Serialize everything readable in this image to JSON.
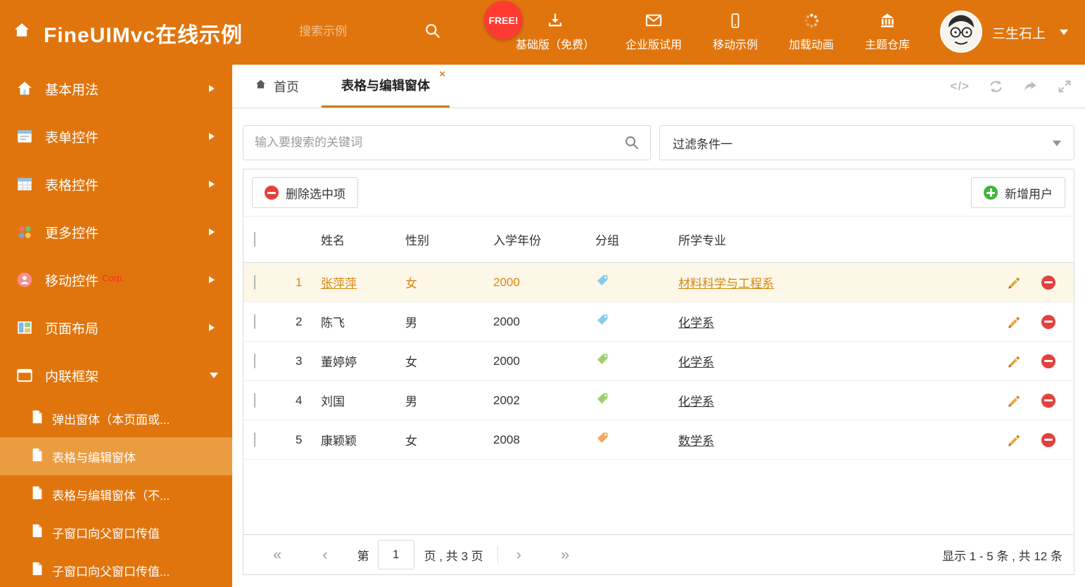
{
  "header": {
    "title": "FineUIMvc在线示例",
    "search_placeholder": "搜索示例",
    "free_badge": "FREE!",
    "accent_color": "#e1750d",
    "nav_items": [
      {
        "label": "基础版（免费）",
        "icon": "download-icon"
      },
      {
        "label": "企业版试用",
        "icon": "envelope-icon"
      },
      {
        "label": "移动示例",
        "icon": "mobile-icon"
      },
      {
        "label": "加载动画",
        "icon": "spinner-icon"
      },
      {
        "label": "主题仓库",
        "icon": "bank-icon"
      }
    ],
    "user": {
      "name": "三生石上"
    }
  },
  "sidebar": {
    "items": [
      {
        "label": "基本用法"
      },
      {
        "label": "表单控件"
      },
      {
        "label": "表格控件"
      },
      {
        "label": "更多控件"
      },
      {
        "label": "移动控件",
        "badge": "Corp."
      },
      {
        "label": "页面布局"
      },
      {
        "label": "内联框架"
      }
    ],
    "subitems": [
      {
        "label": "弹出窗体（本页面或..."
      },
      {
        "label": "表格与编辑窗体"
      },
      {
        "label": "表格与编辑窗体（不..."
      },
      {
        "label": "子窗口向父窗口传值"
      },
      {
        "label": "子窗口向父窗口传值..."
      }
    ]
  },
  "main": {
    "tabs": [
      {
        "label": "首页"
      },
      {
        "label": "表格与编辑窗体",
        "close_glyph": "×"
      }
    ],
    "tools_code_glyph": "</>"
  },
  "filters": {
    "search_placeholder": "输入要搜索的关键词",
    "filter_value": "过滤条件一"
  },
  "grid": {
    "toolbar": {
      "delete_label": "删除选中项",
      "add_label": "新增用户"
    },
    "columns": [
      "姓名",
      "性别",
      "入学年份",
      "分组",
      "所学专业"
    ],
    "rows": [
      {
        "num": "1",
        "name": "张萍萍",
        "gender": "女",
        "year": "2000",
        "tag_color": "#85cbee",
        "major": "材料科学与工程系"
      },
      {
        "num": "2",
        "name": "陈飞",
        "gender": "男",
        "year": "2000",
        "tag_color": "#85cbee",
        "major": "化学系"
      },
      {
        "num": "3",
        "name": "董婷婷",
        "gender": "女",
        "year": "2000",
        "tag_color": "#9cd06c",
        "major": "化学系"
      },
      {
        "num": "4",
        "name": "刘国",
        "gender": "男",
        "year": "2002",
        "tag_color": "#9cd06c",
        "major": "化学系"
      },
      {
        "num": "5",
        "name": "康颖颖",
        "gender": "女",
        "year": "2008",
        "tag_color": "#f0a95f",
        "major": "数学系"
      }
    ],
    "pagination": {
      "first_glyph": "«",
      "prev_glyph": "‹",
      "next_glyph": "›",
      "last_glyph": "»",
      "page_prefix": "第",
      "current_page": "1",
      "page_count_text": "页 , 共 3 页",
      "summary": "显示 1 - 5 条 , 共 12 条"
    }
  }
}
